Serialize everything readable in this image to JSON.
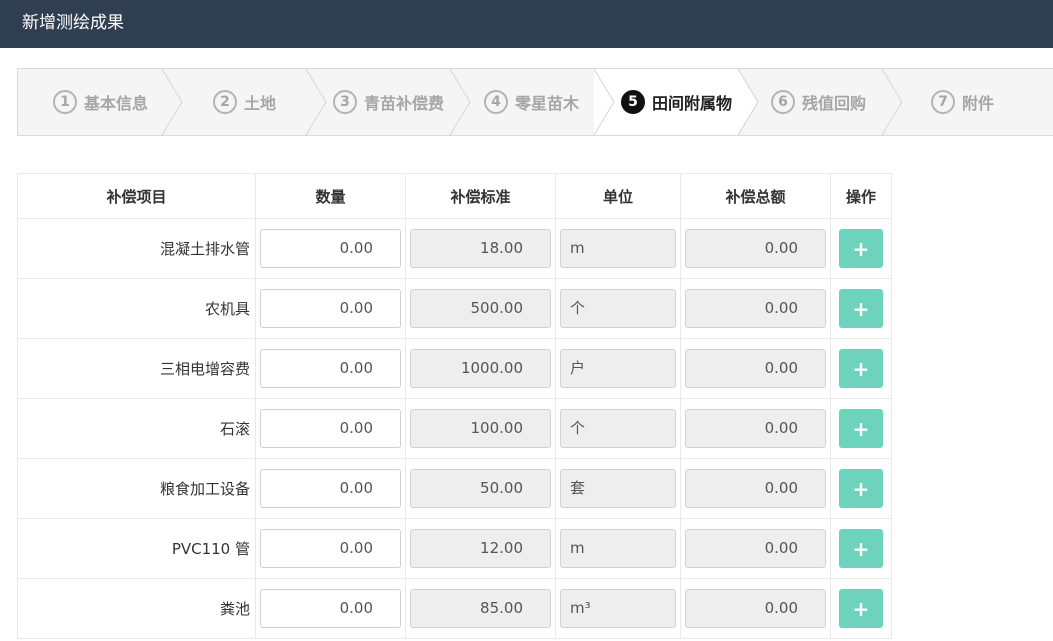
{
  "header": {
    "title": "新增测绘成果"
  },
  "steps": [
    {
      "num": "1",
      "label": "基本信息",
      "active": false
    },
    {
      "num": "2",
      "label": "土地",
      "active": false
    },
    {
      "num": "3",
      "label": "青苗补偿费",
      "active": false
    },
    {
      "num": "4",
      "label": "零星苗木",
      "active": false
    },
    {
      "num": "5",
      "label": "田间附属物",
      "active": true
    },
    {
      "num": "6",
      "label": "残值回购",
      "active": false
    },
    {
      "num": "7",
      "label": "附件",
      "active": false
    }
  ],
  "table": {
    "headers": [
      "补偿项目",
      "数量",
      "补偿标准",
      "单位",
      "补偿总额",
      "操作"
    ],
    "add_icon": "plus-icon",
    "rows": [
      {
        "name": "混凝土排水管",
        "qty": "0.00",
        "std": "18.00",
        "unit": "m",
        "total": "0.00"
      },
      {
        "name": "农机具",
        "qty": "0.00",
        "std": "500.00",
        "unit": "个",
        "total": "0.00"
      },
      {
        "name": "三相电增容费",
        "qty": "0.00",
        "std": "1000.00",
        "unit": "户",
        "total": "0.00"
      },
      {
        "name": "石滚",
        "qty": "0.00",
        "std": "100.00",
        "unit": "个",
        "total": "0.00"
      },
      {
        "name": "粮食加工设备",
        "qty": "0.00",
        "std": "50.00",
        "unit": "套",
        "total": "0.00"
      },
      {
        "name": "PVC110 管",
        "qty": "0.00",
        "std": "12.00",
        "unit": "m",
        "total": "0.00"
      },
      {
        "name": "粪池",
        "qty": "0.00",
        "std": "85.00",
        "unit": "m³",
        "total": "0.00"
      }
    ]
  },
  "colors": {
    "header_bg": "#2f3e50",
    "add_button": "#6ed3bd",
    "readonly_bg": "#eeeeee"
  }
}
